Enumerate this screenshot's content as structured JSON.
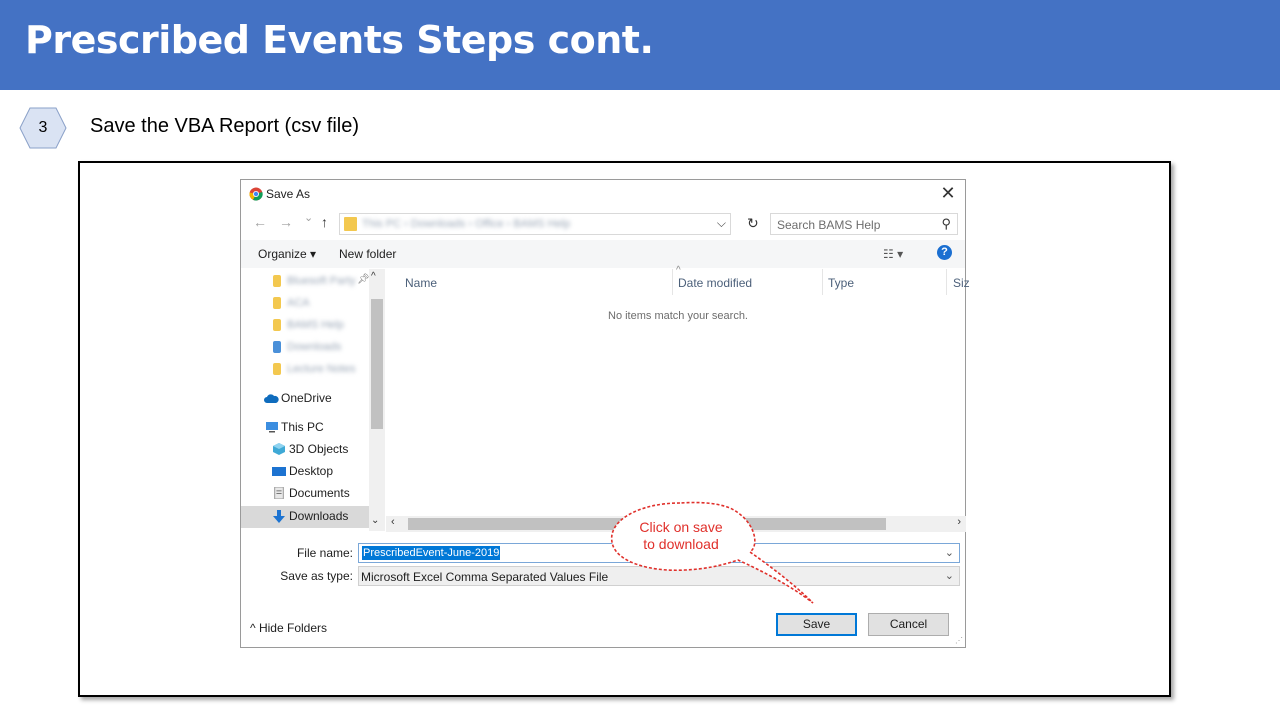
{
  "slide": {
    "title": "Prescribed Events Steps cont.",
    "step_number": "3",
    "step_text": "Save the VBA Report (csv file)"
  },
  "dialog": {
    "title": "Save As",
    "close_glyph": "✕",
    "nav": {
      "back": "←",
      "forward": "→",
      "recent": "⌄",
      "up": "↑"
    },
    "address_blurred": "This PC  ›  Downloads  ›  Office  ›  BAMS Help",
    "refresh_glyph": "↻",
    "search_placeholder": "Search BAMS Help",
    "toolbar": {
      "organize": "Organize ▾",
      "new_folder": "New folder",
      "view_glyph": "☷ ▾",
      "help_glyph": "?"
    },
    "nav_pane": {
      "quick_access_blurred": [
        "Bluesoft Party",
        "ACA",
        "BAMS Help",
        "Downloads",
        "Lecture Notes"
      ],
      "onedrive": "OneDrive",
      "this_pc": "This PC",
      "items": [
        "3D Objects",
        "Desktop",
        "Documents",
        "Downloads"
      ]
    },
    "columns": [
      "Name",
      "Date modified",
      "Type",
      "Siz"
    ],
    "empty_message": "No items match your search.",
    "file_name_label": "File name:",
    "file_name_value": "PrescribedEvent-June-2019",
    "save_type_label": "Save as type:",
    "save_type_value": "Microsoft Excel Comma Separated Values File",
    "hide_folders": "Hide Folders",
    "save_label": "Save",
    "cancel_label": "Cancel"
  },
  "callout": {
    "line1": "Click on save",
    "line2": "to download",
    "color": "#e0302b"
  },
  "colors": {
    "title_bar": "#4472c4",
    "selection": "#0078d7"
  }
}
